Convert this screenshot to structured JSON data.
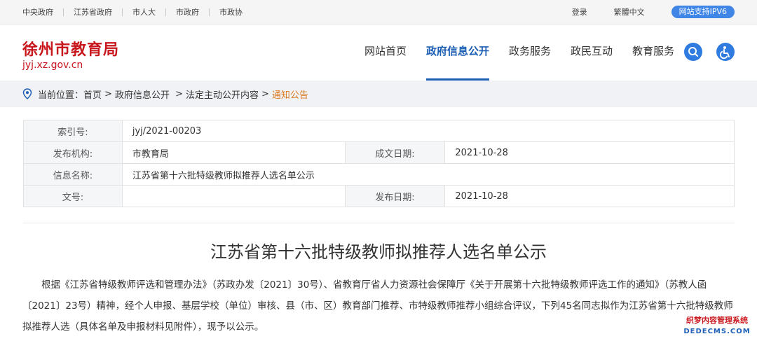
{
  "topbar": {
    "links": [
      "中央政府",
      "江苏省政府",
      "市人大",
      "市政府",
      "市政协"
    ],
    "login": "登录",
    "traditional": "繁體中文",
    "ipv6": "网站支持IPV6"
  },
  "header": {
    "title": "徐州市教育局",
    "url": "jyj.xz.gov.cn",
    "nav": [
      "网站首页",
      "政府信息公开",
      "政务服务",
      "政民互动",
      "教育服务"
    ],
    "active_nav": "政府信息公开"
  },
  "breadcrumb": {
    "prefix": "当前位置：",
    "items": [
      "首页",
      "政府信息公开",
      "法定主动公开内容"
    ],
    "current": "通知公告"
  },
  "info": {
    "index_label": "索引号:",
    "index_value": "jyj/2021-00203",
    "org_label": "发布机构:",
    "org_value": "市教育局",
    "formed_label": "成文日期:",
    "formed_value": "2021-10-28",
    "name_label": "信息名称:",
    "name_value": "江苏省第十六批特级教师拟推荐人选名单公示",
    "docno_label": "文号:",
    "docno_value": "",
    "publish_label": "发布日期:",
    "publish_value": "2021-10-28"
  },
  "article": {
    "title": "江苏省第十六批特级教师拟推荐人选名单公示",
    "body": "根据《江苏省特级教师评选和管理办法》（苏政办发〔2021〕30号）、省教育厅省人力资源社会保障厅《关于开展第十六批特级教师评选工作的通知》（苏教人函〔2021〕23号）精神，经个人申报、基层学校（单位）审核、县（市、区）教育部门推荐、市特级教师推荐小组综合评议，下列45名同志拟作为江苏省第十六批特级教师拟推荐人选（具体名单及申报材料见附件），现予以公示。"
  },
  "watermark": {
    "line1": "织梦内容管理系统",
    "line2": "DEDECMS.COM"
  },
  "colors": {
    "brand_red": "#c8161d",
    "nav_blue": "#1d5fb5",
    "crumb_current": "#d97a1f",
    "button_blue": "#2f7be0"
  },
  "icons": {
    "search": "search-icon",
    "accessibility": "accessibility-icon",
    "location": "location-pin-icon"
  }
}
